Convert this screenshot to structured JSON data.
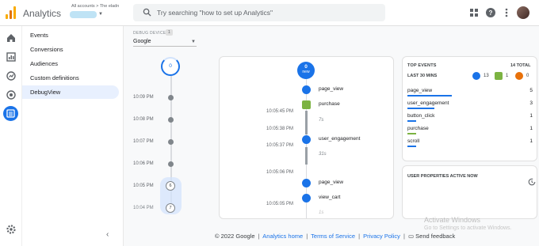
{
  "header": {
    "app_title": "Analytics",
    "account_path": "All accounts > The eladn",
    "search_placeholder": "Try searching \"how to set up Analytics\""
  },
  "nav": {
    "items": [
      {
        "label": "Events"
      },
      {
        "label": "Conversions"
      },
      {
        "label": "Audiences"
      },
      {
        "label": "Custom definitions"
      },
      {
        "label": "DebugView",
        "active": true
      }
    ]
  },
  "debug": {
    "device_label": "DEBUG DEVICE",
    "device_count": "1",
    "device_value": "Google"
  },
  "minutes": {
    "top_count": "0",
    "times": [
      "10:09 PM",
      "10:08 PM",
      "10:07 PM",
      "10:06 PM",
      "10:05 PM",
      "10:04 PM"
    ],
    "counts": [
      "6",
      "7"
    ]
  },
  "stream": {
    "new_count": "0",
    "new_label": "new",
    "events": [
      {
        "name": "page_view",
        "icon": "person-icon"
      },
      {
        "name": "purchase",
        "icon": "flag-icon"
      },
      {
        "name": "user_engagement",
        "icon": "person-icon"
      },
      {
        "name": "page_view",
        "icon": "person-icon"
      },
      {
        "name": "view_cart",
        "icon": "person-icon"
      }
    ],
    "times": [
      "10:05:45 PM",
      "10:05:38 PM",
      "10:05:37 PM",
      "10:05:06 PM",
      "10:05:05 PM"
    ],
    "durations": [
      "7s",
      "31s",
      "1s"
    ]
  },
  "top_events": {
    "title": "TOP EVENTS",
    "total": "14 TOTAL",
    "subtitle": "LAST 30 MINS",
    "counts": {
      "blue": "13",
      "green": "1",
      "orange": "0"
    },
    "rows": [
      {
        "name": "page_view",
        "value": "5",
        "fill": 1.0
      },
      {
        "name": "user_engagement",
        "value": "3",
        "fill": 0.6
      },
      {
        "name": "button_click",
        "value": "1",
        "fill": 0.2
      },
      {
        "name": "purchase",
        "value": "1",
        "fill": 0.2
      },
      {
        "name": "scroll",
        "value": "1",
        "fill": 0.2
      }
    ]
  },
  "user_properties": {
    "title": "USER PROPERTIES ACTIVE NOW"
  },
  "footer": {
    "copyright": "© 2022 Google",
    "analytics_home": "Analytics home",
    "terms": "Terms of Service",
    "privacy": "Privacy Policy",
    "feedback": "Send feedback"
  },
  "watermark": {
    "line1": "Activate Windows",
    "line2": "Go to Settings to activate Windows."
  },
  "colors": {
    "accent": "#1a73e8",
    "green": "#7cb342",
    "orange": "#e8710a",
    "logo": "#f9ab00"
  }
}
